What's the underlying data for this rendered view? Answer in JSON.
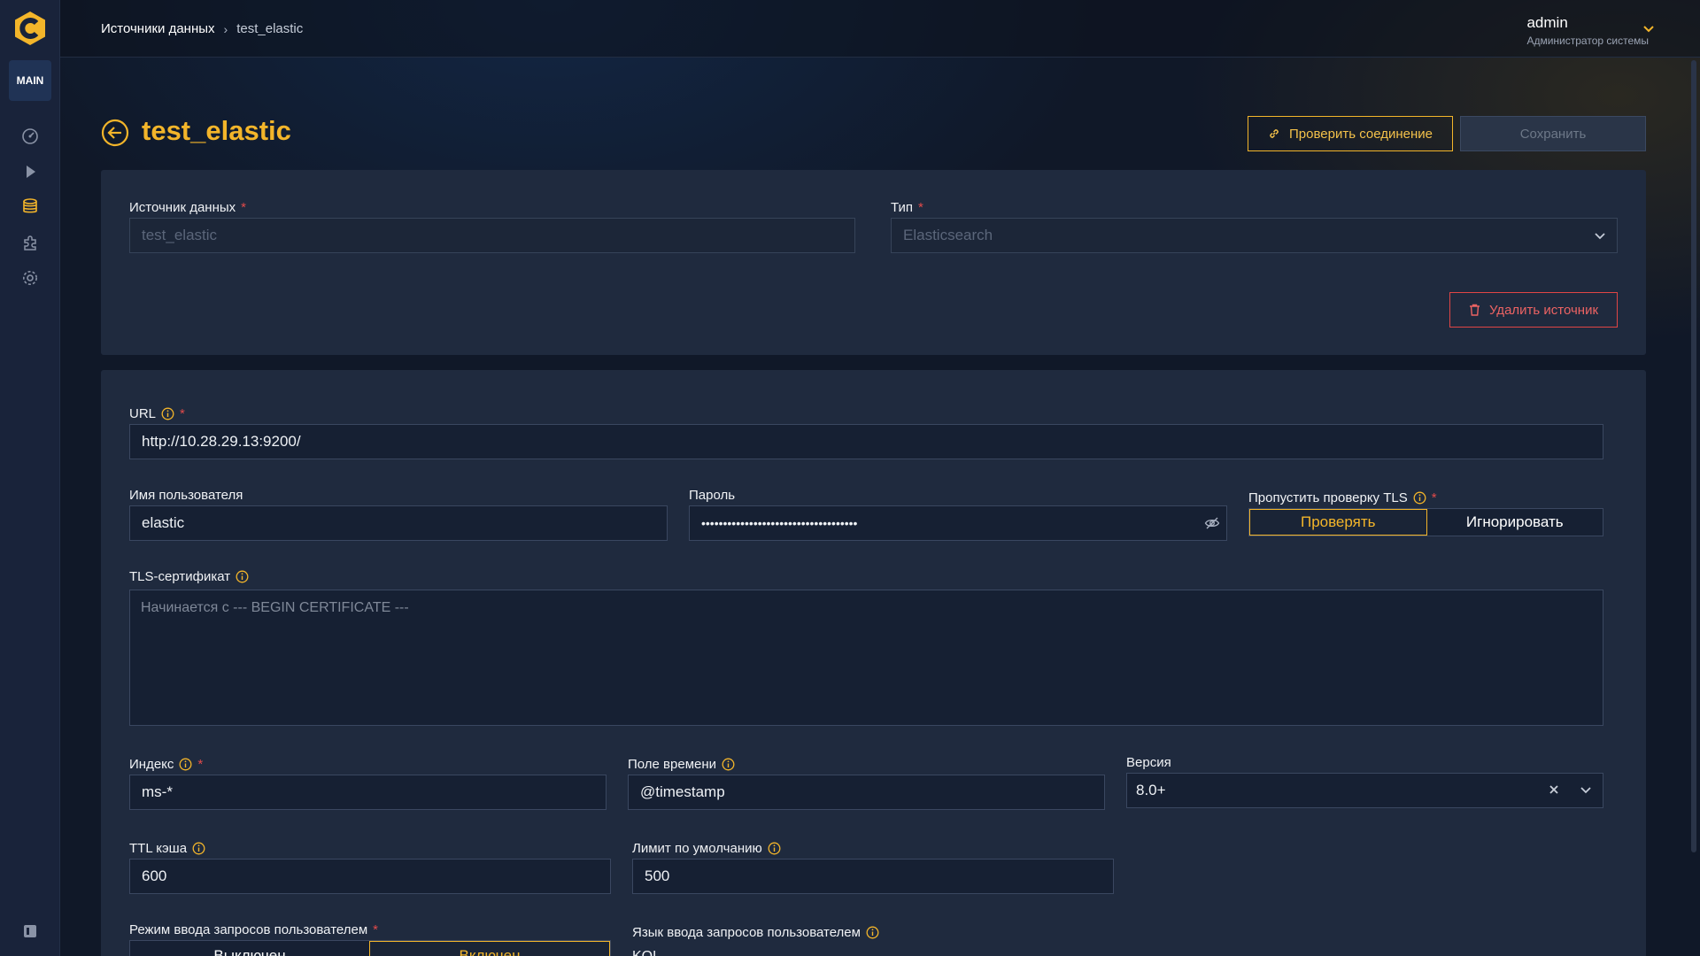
{
  "sidebar": {
    "main_badge": "MAIN",
    "icons": [
      "dashboard-icon",
      "play-icon",
      "database-icon",
      "plugin-icon",
      "settings-icon"
    ],
    "accent": "#f3b52a"
  },
  "topbar": {
    "breadcrumb_root": "Источники данных",
    "breadcrumb_sep": "›",
    "breadcrumb_current": "test_elastic",
    "user_name": "admin",
    "user_role": "Администратор системы"
  },
  "header": {
    "title": "test_elastic",
    "check_button": "Проверить соединение",
    "save_button": "Сохранить"
  },
  "general": {
    "source_label": "Источник данных",
    "source_value": "test_elastic",
    "type_label": "Тип",
    "type_value": "Elasticsearch",
    "delete_button": "Удалить источник",
    "required_mark": "*"
  },
  "connection": {
    "url_label": "URL",
    "url_value": "http://10.28.29.13:9200/",
    "username_label": "Имя пользователя",
    "username_value": "elastic",
    "password_label": "Пароль",
    "password_value": "••••••••••••••••••••••••••••••••••••",
    "tls_skip_label": "Пропустить проверку TLS",
    "tls_options": [
      "Проверять",
      "Игнорировать"
    ],
    "tls_selected": "Проверять",
    "cert_label": "TLS-сертификат",
    "cert_placeholder": "Начинается с --- BEGIN CERTIFICATE ---",
    "index_label": "Индекс",
    "index_value": "ms-*",
    "time_field_label": "Поле времени",
    "time_field_value": "@timestamp",
    "version_label": "Версия",
    "version_value": "8.0+",
    "cache_ttl_label": "TTL кэша",
    "cache_ttl_value": "600",
    "limit_label": "Лимит по умолчанию",
    "limit_value": "500",
    "query_mode_label": "Режим ввода запросов пользователем",
    "query_mode_options": [
      "Выключен",
      "Включен"
    ],
    "query_mode_selected": "Включен",
    "query_lang_label": "Язык ввода запросов пользователем",
    "query_lang_value": "KQL"
  }
}
